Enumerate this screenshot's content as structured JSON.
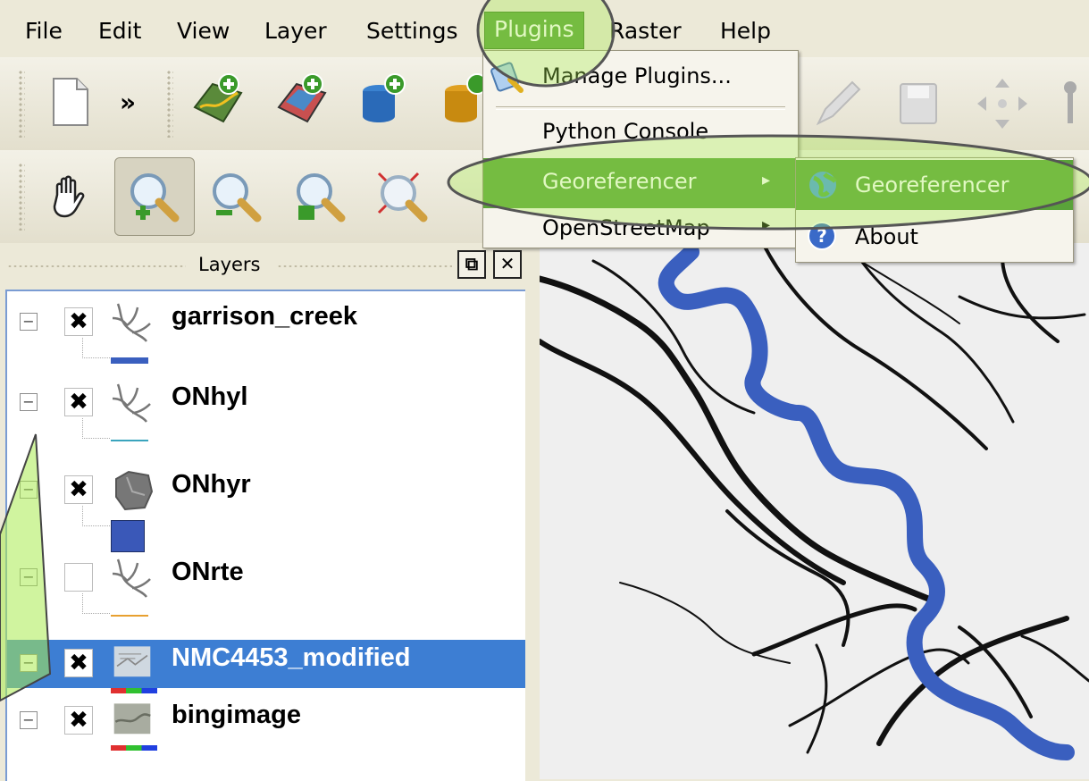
{
  "menubar": {
    "items": [
      "File",
      "Edit",
      "View",
      "Layer",
      "Settings",
      "Plugins",
      "Raster",
      "Help"
    ]
  },
  "plugins_menu": {
    "items": [
      {
        "label": "Manage Plugins...",
        "icon": "plugin-manager-icon"
      },
      {
        "label": "Python Console"
      },
      {
        "label": "Georeferencer",
        "submenu": true
      },
      {
        "label": "OpenStreetMap",
        "submenu": true
      }
    ]
  },
  "georeferencer_submenu": {
    "items": [
      {
        "label": "Georeferencer",
        "icon": "globe-icon"
      },
      {
        "label": "About",
        "icon": "info-icon"
      }
    ]
  },
  "layers_panel": {
    "title": "Layers",
    "layers": [
      {
        "name": "garrison_creek",
        "checked": true,
        "type": "line-layer-icon",
        "symbol_color": "#3a5fbf"
      },
      {
        "name": "ONhyl",
        "checked": true,
        "type": "line-layer-icon",
        "symbol_color": "#3aa4bd"
      },
      {
        "name": "ONhyr",
        "checked": true,
        "type": "polygon-layer-icon",
        "symbol_color": "#3a58b8"
      },
      {
        "name": "ONrte",
        "checked": false,
        "type": "line-layer-icon",
        "symbol_color": "#e8a030"
      },
      {
        "name": "NMC4453_modified",
        "checked": true,
        "type": "raster-layer-icon",
        "selected": true
      },
      {
        "name": "bingimage",
        "checked": true,
        "type": "raster-layer-icon"
      }
    ]
  },
  "colors": {
    "highlight_green": "#5aa33a",
    "selection_blue": "#3d7ed3",
    "creek_blue": "#3a5fbf"
  }
}
